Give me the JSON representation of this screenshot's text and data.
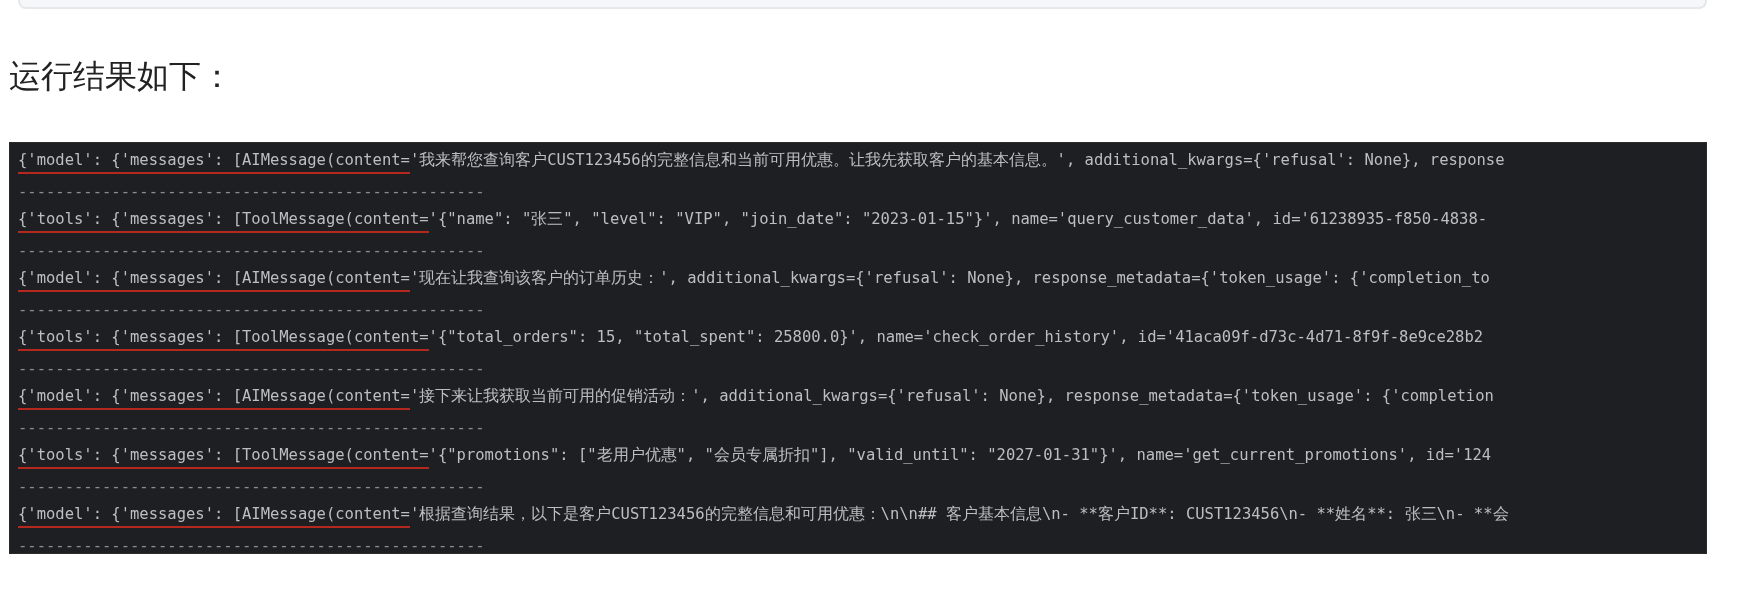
{
  "heading": "运行结果如下：",
  "terminal": {
    "lines": [
      {
        "prefix": "{'model': {'messages': [AIMessage(content=",
        "text": "'我来帮您查询客户CUST123456的完整信息和当前可用优惠。让我先获取客户的基本信息。', additional_kwargs={'refusal': None}, response",
        "underlined": true,
        "separator": "--------------------------------------------------"
      },
      {
        "prefix": "{'tools': {'messages': [ToolMessage(content=",
        "text": "'{\"name\": \"张三\", \"level\": \"VIP\", \"join_date\": \"2023-01-15\"}', name='query_customer_data', id='61238935-f850-4838-",
        "underlined": true,
        "separator": "--------------------------------------------------"
      },
      {
        "prefix": "{'model': {'messages': [AIMessage(content=",
        "text": "'现在让我查询该客户的订单历史：', additional_kwargs={'refusal': None}, response_metadata={'token_usage': {'completion_to",
        "underlined": true,
        "separator": "--------------------------------------------------"
      },
      {
        "prefix": "{'tools': {'messages': [ToolMessage(content=",
        "text": "'{\"total_orders\": 15, \"total_spent\": 25800.0}', name='check_order_history', id='41aca09f-d73c-4d71-8f9f-8e9ce28b2",
        "underlined": true,
        "separator": "--------------------------------------------------"
      },
      {
        "prefix": "{'model': {'messages': [AIMessage(content=",
        "text": "'接下来让我获取当前可用的促销活动：', additional_kwargs={'refusal': None}, response_metadata={'token_usage': {'completion",
        "underlined": true,
        "separator": "--------------------------------------------------"
      },
      {
        "prefix": "{'tools': {'messages': [ToolMessage(content=",
        "text": "'{\"promotions\": [\"老用户优惠\", \"会员专属折扣\"], \"valid_until\": \"2027-01-31\"}', name='get_current_promotions', id='124",
        "underlined": true,
        "separator": "--------------------------------------------------"
      },
      {
        "prefix": "{'model': {'messages': [AIMessage(content=",
        "text": "'根据查询结果，以下是客户CUST123456的完整信息和可用优惠：\\n\\n## 客户基本信息\\n- **客户ID**: CUST123456\\n- **姓名**: 张三\\n- **会",
        "underlined": true,
        "separator": "--------------------------------------------------"
      }
    ]
  }
}
